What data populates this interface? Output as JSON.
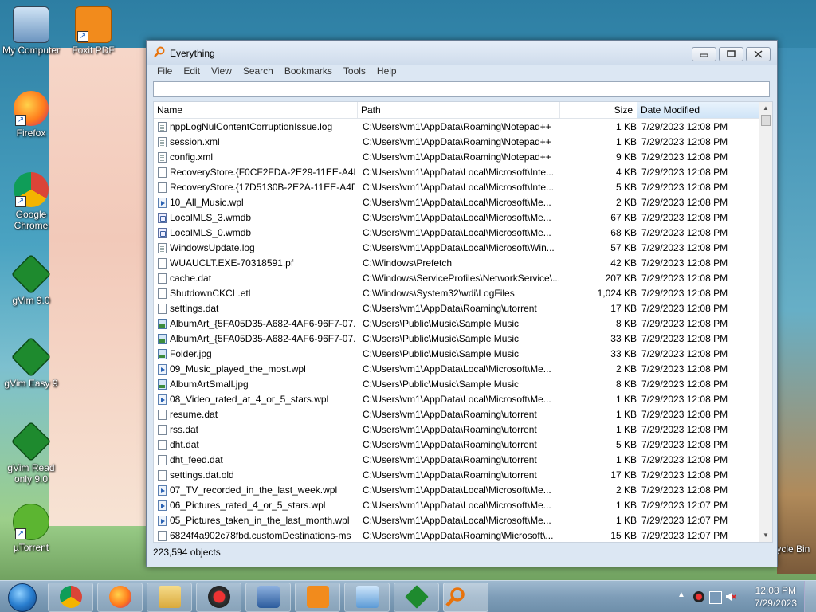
{
  "desktop": {
    "icons": [
      {
        "label": "My Computer"
      },
      {
        "label": "Foxit PDF"
      },
      {
        "label": "Firefox"
      },
      {
        "label": "Google Chrome"
      },
      {
        "label": "gVim 9.0"
      },
      {
        "label": "gVim Easy 9"
      },
      {
        "label": "gVim Read only 9.0"
      },
      {
        "label": "µTorrent"
      },
      {
        "label": "Recycle Bin"
      }
    ]
  },
  "window": {
    "title": "Everything",
    "menu": [
      "File",
      "Edit",
      "View",
      "Search",
      "Bookmarks",
      "Tools",
      "Help"
    ],
    "search_value": "",
    "columns": {
      "name": "Name",
      "path": "Path",
      "size": "Size",
      "date": "Date Modified"
    },
    "rows": [
      {
        "icon": "doc",
        "name": "nppLogNulContentCorruptionIssue.log",
        "path": "C:\\Users\\vm1\\AppData\\Roaming\\Notepad++",
        "size": "1 KB",
        "date": "7/29/2023 12:08 PM"
      },
      {
        "icon": "doc",
        "name": "session.xml",
        "path": "C:\\Users\\vm1\\AppData\\Roaming\\Notepad++",
        "size": "1 KB",
        "date": "7/29/2023 12:08 PM"
      },
      {
        "icon": "doc",
        "name": "config.xml",
        "path": "C:\\Users\\vm1\\AppData\\Roaming\\Notepad++",
        "size": "9 KB",
        "date": "7/29/2023 12:08 PM"
      },
      {
        "icon": "blank",
        "name": "RecoveryStore.{F0CF2FDA-2E29-11EE-A4D...",
        "path": "C:\\Users\\vm1\\AppData\\Local\\Microsoft\\Inte...",
        "size": "4 KB",
        "date": "7/29/2023 12:08 PM"
      },
      {
        "icon": "blank",
        "name": "RecoveryStore.{17D5130B-2E2A-11EE-A4D...",
        "path": "C:\\Users\\vm1\\AppData\\Local\\Microsoft\\Inte...",
        "size": "5 KB",
        "date": "7/29/2023 12:08 PM"
      },
      {
        "icon": "wpl",
        "name": "10_All_Music.wpl",
        "path": "C:\\Users\\vm1\\AppData\\Local\\Microsoft\\Me...",
        "size": "2 KB",
        "date": "7/29/2023 12:08 PM"
      },
      {
        "icon": "db",
        "name": "LocalMLS_3.wmdb",
        "path": "C:\\Users\\vm1\\AppData\\Local\\Microsoft\\Me...",
        "size": "67 KB",
        "date": "7/29/2023 12:08 PM"
      },
      {
        "icon": "db",
        "name": "LocalMLS_0.wmdb",
        "path": "C:\\Users\\vm1\\AppData\\Local\\Microsoft\\Me...",
        "size": "68 KB",
        "date": "7/29/2023 12:08 PM"
      },
      {
        "icon": "doc",
        "name": "WindowsUpdate.log",
        "path": "C:\\Users\\vm1\\AppData\\Local\\Microsoft\\Win...",
        "size": "57 KB",
        "date": "7/29/2023 12:08 PM"
      },
      {
        "icon": "blank",
        "name": "WUAUCLT.EXE-70318591.pf",
        "path": "C:\\Windows\\Prefetch",
        "size": "42 KB",
        "date": "7/29/2023 12:08 PM"
      },
      {
        "icon": "blank",
        "name": "cache.dat",
        "path": "C:\\Windows\\ServiceProfiles\\NetworkService\\...",
        "size": "207 KB",
        "date": "7/29/2023 12:08 PM"
      },
      {
        "icon": "blank",
        "name": "ShutdownCKCL.etl",
        "path": "C:\\Windows\\System32\\wdi\\LogFiles",
        "size": "1,024 KB",
        "date": "7/29/2023 12:08 PM"
      },
      {
        "icon": "blank",
        "name": "settings.dat",
        "path": "C:\\Users\\vm1\\AppData\\Roaming\\utorrent",
        "size": "17 KB",
        "date": "7/29/2023 12:08 PM"
      },
      {
        "icon": "img",
        "name": "AlbumArt_{5FA05D35-A682-4AF6-96F7-07...",
        "path": "C:\\Users\\Public\\Music\\Sample Music",
        "size": "8 KB",
        "date": "7/29/2023 12:08 PM"
      },
      {
        "icon": "img",
        "name": "AlbumArt_{5FA05D35-A682-4AF6-96F7-07...",
        "path": "C:\\Users\\Public\\Music\\Sample Music",
        "size": "33 KB",
        "date": "7/29/2023 12:08 PM"
      },
      {
        "icon": "img",
        "name": "Folder.jpg",
        "path": "C:\\Users\\Public\\Music\\Sample Music",
        "size": "33 KB",
        "date": "7/29/2023 12:08 PM"
      },
      {
        "icon": "wpl",
        "name": "09_Music_played_the_most.wpl",
        "path": "C:\\Users\\vm1\\AppData\\Local\\Microsoft\\Me...",
        "size": "2 KB",
        "date": "7/29/2023 12:08 PM"
      },
      {
        "icon": "img",
        "name": "AlbumArtSmall.jpg",
        "path": "C:\\Users\\Public\\Music\\Sample Music",
        "size": "8 KB",
        "date": "7/29/2023 12:08 PM"
      },
      {
        "icon": "wpl",
        "name": "08_Video_rated_at_4_or_5_stars.wpl",
        "path": "C:\\Users\\vm1\\AppData\\Local\\Microsoft\\Me...",
        "size": "1 KB",
        "date": "7/29/2023 12:08 PM"
      },
      {
        "icon": "blank",
        "name": "resume.dat",
        "path": "C:\\Users\\vm1\\AppData\\Roaming\\utorrent",
        "size": "1 KB",
        "date": "7/29/2023 12:08 PM"
      },
      {
        "icon": "blank",
        "name": "rss.dat",
        "path": "C:\\Users\\vm1\\AppData\\Roaming\\utorrent",
        "size": "1 KB",
        "date": "7/29/2023 12:08 PM"
      },
      {
        "icon": "blank",
        "name": "dht.dat",
        "path": "C:\\Users\\vm1\\AppData\\Roaming\\utorrent",
        "size": "5 KB",
        "date": "7/29/2023 12:08 PM"
      },
      {
        "icon": "blank",
        "name": "dht_feed.dat",
        "path": "C:\\Users\\vm1\\AppData\\Roaming\\utorrent",
        "size": "1 KB",
        "date": "7/29/2023 12:08 PM"
      },
      {
        "icon": "blank",
        "name": "settings.dat.old",
        "path": "C:\\Users\\vm1\\AppData\\Roaming\\utorrent",
        "size": "17 KB",
        "date": "7/29/2023 12:08 PM"
      },
      {
        "icon": "wpl",
        "name": "07_TV_recorded_in_the_last_week.wpl",
        "path": "C:\\Users\\vm1\\AppData\\Local\\Microsoft\\Me...",
        "size": "2 KB",
        "date": "7/29/2023 12:08 PM"
      },
      {
        "icon": "wpl",
        "name": "06_Pictures_rated_4_or_5_stars.wpl",
        "path": "C:\\Users\\vm1\\AppData\\Local\\Microsoft\\Me...",
        "size": "1 KB",
        "date": "7/29/2023 12:07 PM"
      },
      {
        "icon": "wpl",
        "name": "05_Pictures_taken_in_the_last_month.wpl",
        "path": "C:\\Users\\vm1\\AppData\\Local\\Microsoft\\Me...",
        "size": "1 KB",
        "date": "7/29/2023 12:07 PM"
      },
      {
        "icon": "blank",
        "name": "6824f4a902c78fbd.customDestinations-ms",
        "path": "C:\\Users\\vm1\\AppData\\Roaming\\Microsoft\\...",
        "size": "15 KB",
        "date": "7/29/2023 12:07 PM"
      }
    ],
    "status": "223,594 objects"
  },
  "taskbar": {
    "apps": [
      "chrome-icon",
      "firefox-icon",
      "explorer-icon",
      "app-red-icon",
      "media-icon",
      "foxit-icon",
      "control-panel-icon",
      "vim-icon",
      "everything-icon"
    ],
    "clock_time": "12:08 PM",
    "clock_date": "7/29/2023"
  },
  "colors": {
    "accent": "#cfe4f7",
    "window_frame": "#dce7f3"
  }
}
